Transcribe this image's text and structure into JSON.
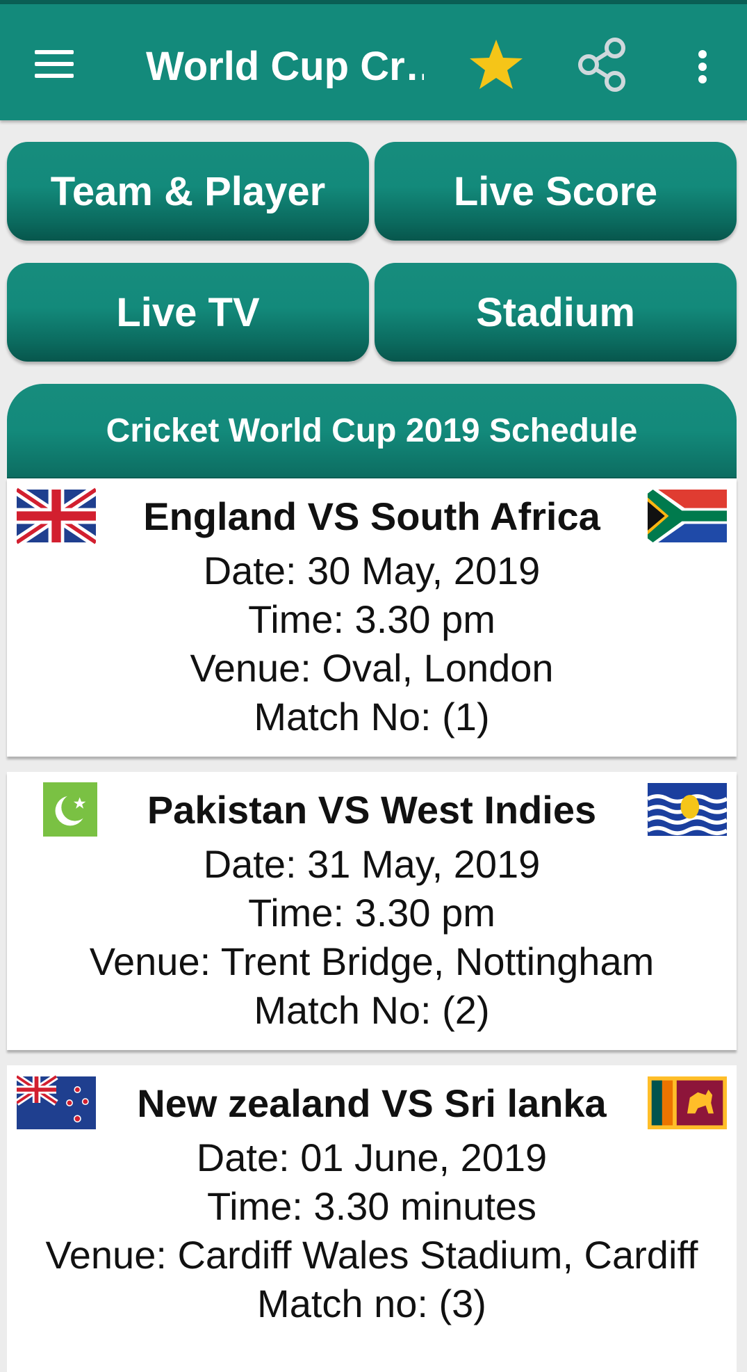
{
  "appbar": {
    "title": "World Cup Cr…",
    "icons": [
      "menu-icon",
      "star-icon",
      "share-icon",
      "more-vert-icon"
    ]
  },
  "nav_buttons": [
    {
      "label": "Team & Player"
    },
    {
      "label": "Live Score"
    },
    {
      "label": "Live TV"
    },
    {
      "label": "Stadium"
    }
  ],
  "schedule": {
    "title": "Cricket World Cup 2019 Schedule",
    "matches": [
      {
        "teams": "England VS South Africa",
        "date": "Date: 30 May, 2019",
        "time": "Time: 3.30 pm",
        "venue": "Venue: Oval, London",
        "match_no": "Match No: (1)",
        "flag_left": "england-flag-icon",
        "flag_right": "south-africa-flag-icon"
      },
      {
        "teams": "Pakistan VS West Indies",
        "date": "Date: 31 May, 2019",
        "time": "Time: 3.30 pm",
        "venue": "Venue: Trent Bridge, Nottingham",
        "match_no": "Match No: (2)",
        "flag_left": "pakistan-flag-icon",
        "flag_right": "west-indies-flag-icon"
      },
      {
        "teams": "New zealand VS Sri lanka",
        "date": "Date: 01 June, 2019",
        "time": "Time: 3.30 minutes",
        "venue": "Venue: Cardiff Wales Stadium, Cardiff",
        "match_no": "Match no: (3)",
        "flag_left": "new-zealand-flag-icon",
        "flag_right": "sri-lanka-flag-icon"
      }
    ]
  },
  "colors": {
    "primary": "#138a7b",
    "primary_dark": "#0a5e54",
    "star": "#f5c518",
    "background": "#ececec"
  }
}
